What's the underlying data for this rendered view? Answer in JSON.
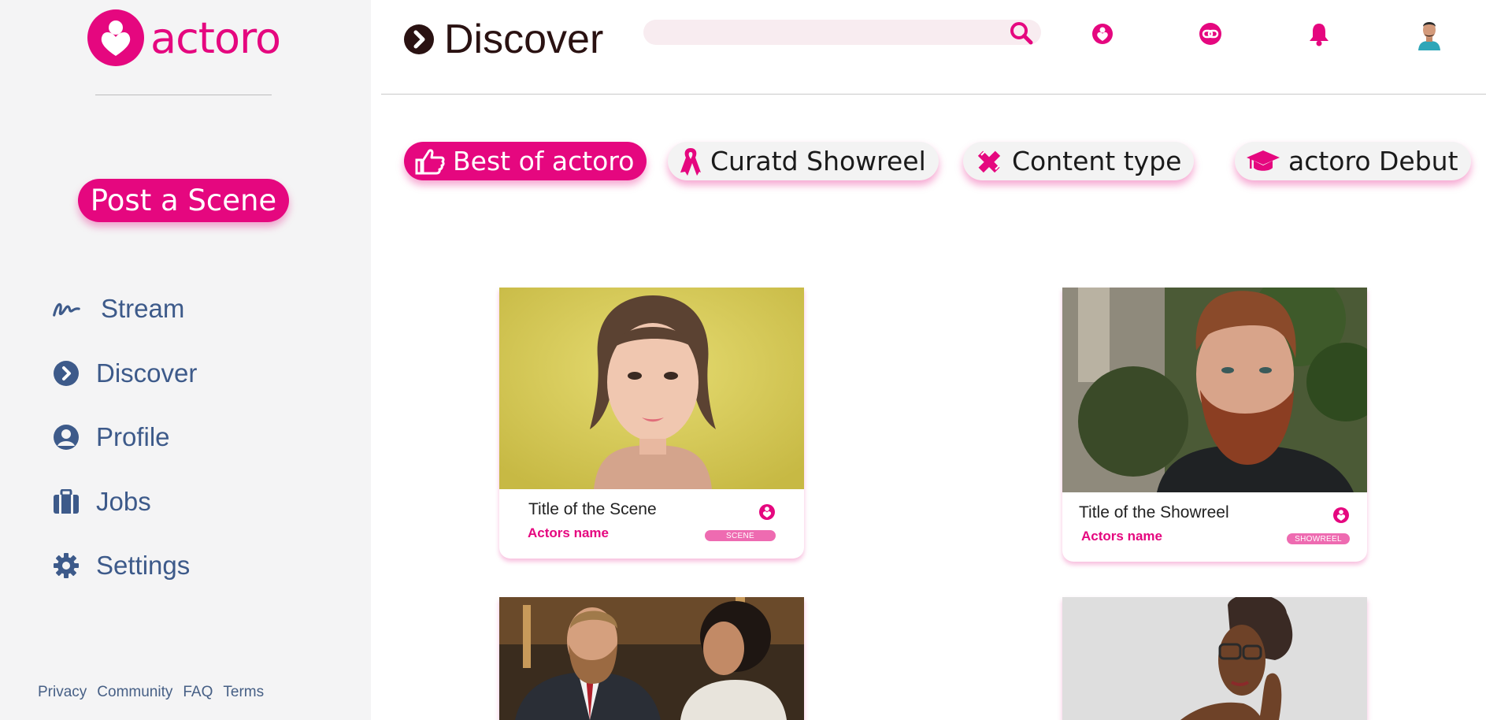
{
  "app": {
    "name": "actoro"
  },
  "sidebar": {
    "post_button": "Post a Scene",
    "nav": [
      {
        "label": "Stream",
        "icon": "stream-icon"
      },
      {
        "label": "Discover",
        "icon": "chevron-circle-right-icon"
      },
      {
        "label": "Profile",
        "icon": "user-circle-icon"
      },
      {
        "label": "Jobs",
        "icon": "briefcase-icon"
      },
      {
        "label": "Settings",
        "icon": "gear-icon"
      }
    ],
    "footer": [
      "Privacy",
      "Community",
      "FAQ",
      "Terms"
    ]
  },
  "header": {
    "title": "Discover",
    "search_placeholder": "",
    "icons": [
      "actoro-heart-icon",
      "link-icon",
      "bell-icon",
      "user-avatar"
    ]
  },
  "filters": [
    {
      "label": "Best of actoro",
      "icon": "thumbs-up-icon",
      "active": true
    },
    {
      "label": "Curatd Showreel",
      "icon": "ribbon-icon",
      "active": false
    },
    {
      "label": "Content type",
      "icon": "pencil-ruler-icon",
      "active": false
    },
    {
      "label": "actoro Debut",
      "icon": "graduation-cap-icon",
      "active": false
    }
  ],
  "cards": [
    {
      "title": "Title of the Scene",
      "actor": "Actors name",
      "badge": "SCENE"
    },
    {
      "title": "Title of the Showreel",
      "actor": "Actors name",
      "badge": "SHOWREEL"
    }
  ],
  "colors": {
    "accent": "#e5077f",
    "nav_text": "#3d5a8a",
    "sidebar_bg": "#f4f4f5"
  }
}
